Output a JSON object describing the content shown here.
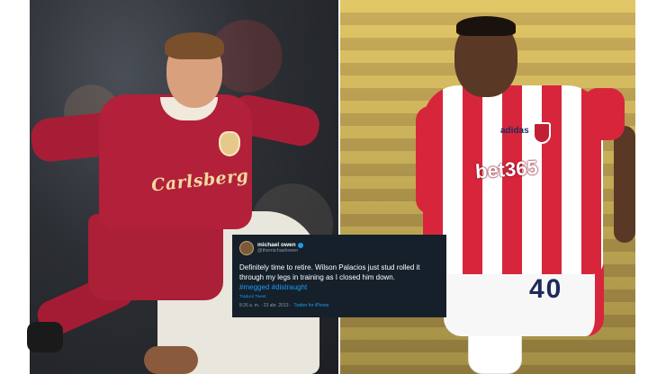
{
  "tweet": {
    "name": "michael owen",
    "handle": "@themichaelowen",
    "text": "Definitely time to retire. Wilson Palacios just stud rolled it through my legs in training as I closed him down.",
    "hashtags": "#megged #distraught",
    "translate": "Traducir Tweet",
    "time": "8:26 a. m. · 23 abr. 2013 ·",
    "source": "Twitter for iPhone"
  },
  "left_photo": {
    "shirt_sponsor": "Carlsberg"
  },
  "right_photo": {
    "shirt_sponsor": "bet365",
    "kit_brand": "adidas",
    "shorts_number": "40"
  },
  "colors": {
    "tweet_bg": "#15202b",
    "link_blue": "#1d9bf0",
    "liverpool_red": "#b3203a",
    "stoke_red": "#d7263b"
  }
}
